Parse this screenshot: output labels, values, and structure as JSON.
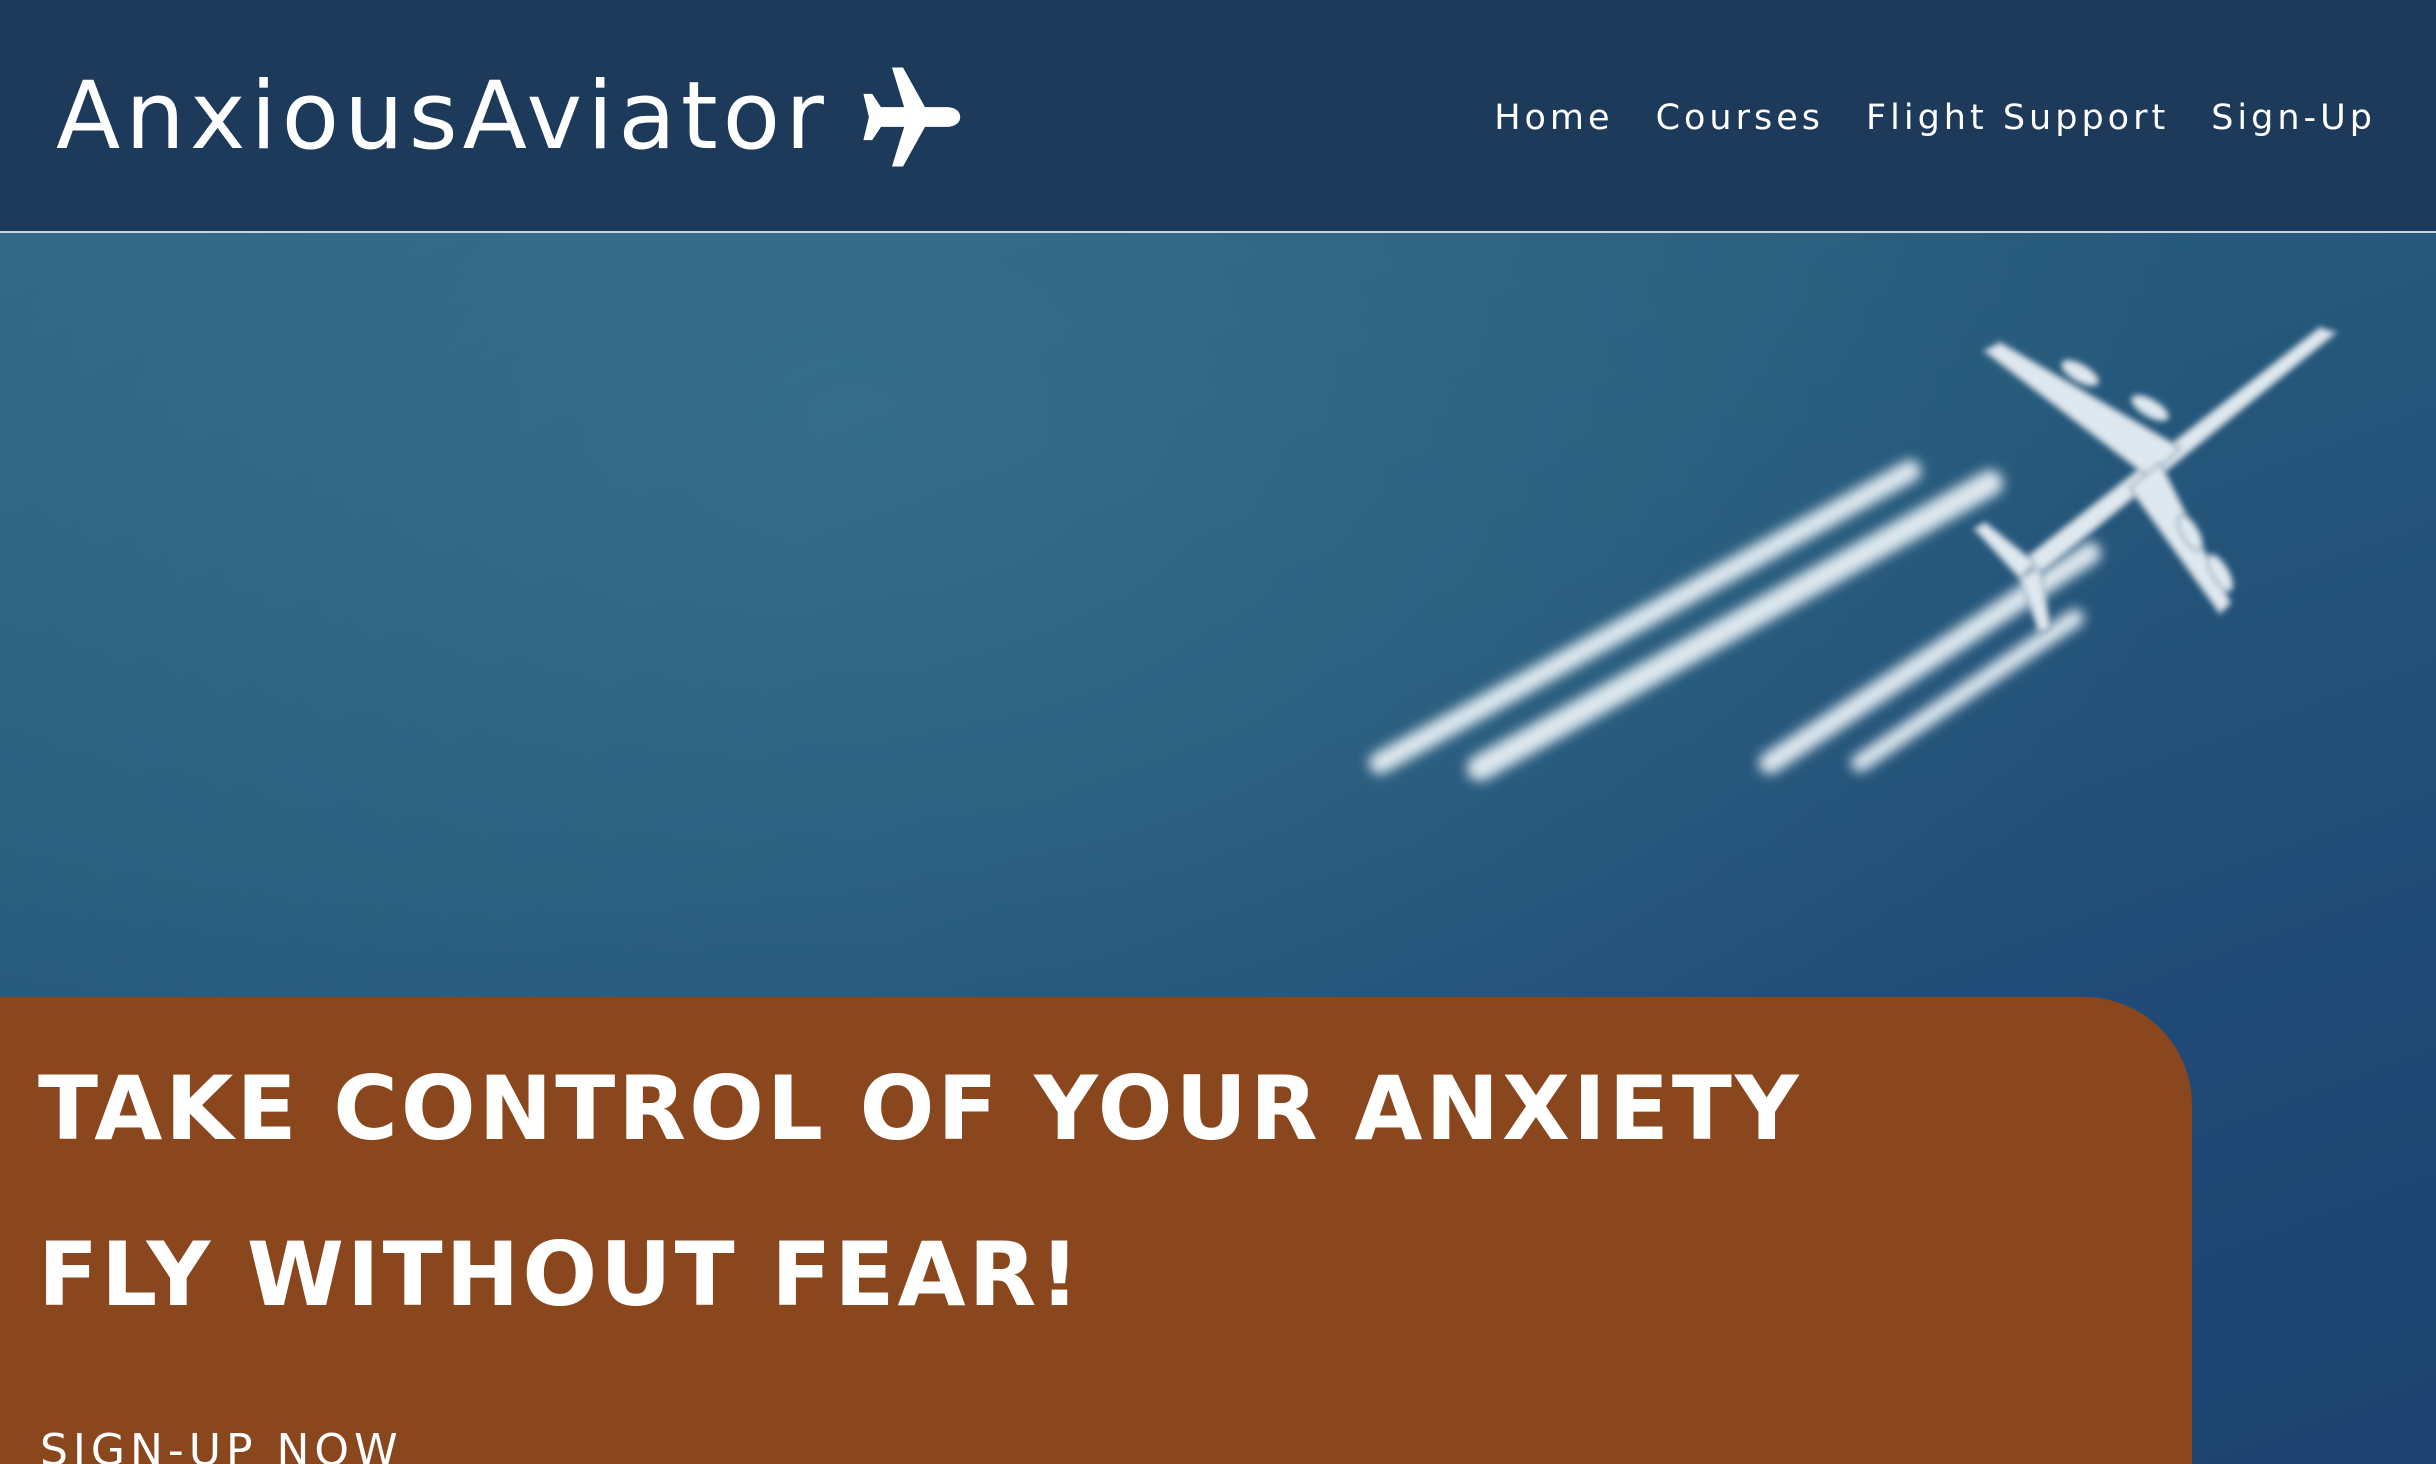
{
  "header": {
    "brand": "AnxiousAviator",
    "brand_icon": "airplane-icon",
    "nav": [
      {
        "label": "Home"
      },
      {
        "label": "Courses"
      },
      {
        "label": "Flight Support"
      },
      {
        "label": "Sign-Up"
      }
    ]
  },
  "hero": {
    "headline_line1": "TAKE CONTROL OF YOUR ANXIETY",
    "headline_line2": "FLY WITHOUT FEAR!",
    "cta_label": "SIGN-UP NOW",
    "background_image": "airplane-with-contrails"
  },
  "colors": {
    "header_bg": "#1d3a5b",
    "panel_bg": "#8a461d",
    "sky": "#26597b",
    "text": "#ffffff"
  }
}
